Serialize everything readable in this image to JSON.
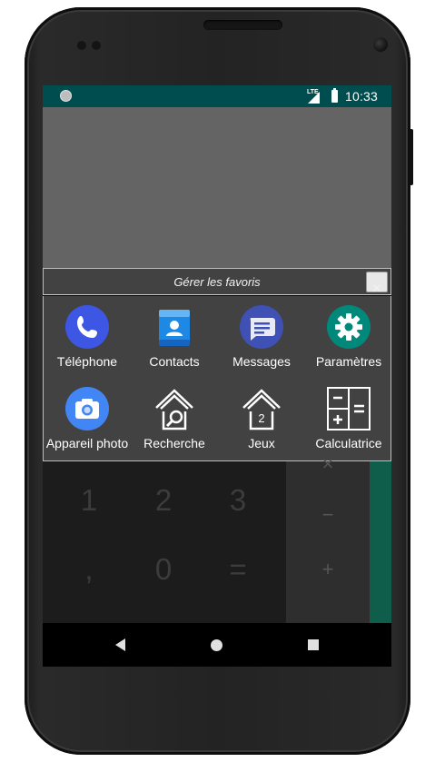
{
  "status_bar": {
    "network": "LTE",
    "time": "10:33"
  },
  "dialog": {
    "title": "Gérer les favoris",
    "close_label": "✕",
    "apps": [
      {
        "label": "Téléphone",
        "icon": "phone-icon",
        "color": "#3d5afe"
      },
      {
        "label": "Contacts",
        "icon": "contacts-icon",
        "color": "#1e88e5"
      },
      {
        "label": "Messages",
        "icon": "messages-icon",
        "color": "#3f51b5"
      },
      {
        "label": "Paramètres",
        "icon": "settings-icon",
        "color": "#00897b"
      },
      {
        "label": "Appareil photo",
        "icon": "camera-icon",
        "color": "#4285f4"
      },
      {
        "label": "Recherche",
        "icon": "house-search-icon",
        "color": "#ffffff"
      },
      {
        "label": "Jeux",
        "icon": "house-games-icon",
        "color": "#ffffff"
      },
      {
        "label": "Calculatrice",
        "icon": "calculator-icon",
        "color": "#ffffff"
      }
    ],
    "jeux_badge": "2"
  },
  "calculator": {
    "keys": [
      "1",
      "2",
      "3",
      ",",
      "0",
      "="
    ],
    "operators": [
      "×",
      "−",
      "+"
    ]
  },
  "colors": {
    "status_bar": "#004d50",
    "dialog_bg": "#424242",
    "teal_accent": "#0f5e4c"
  }
}
